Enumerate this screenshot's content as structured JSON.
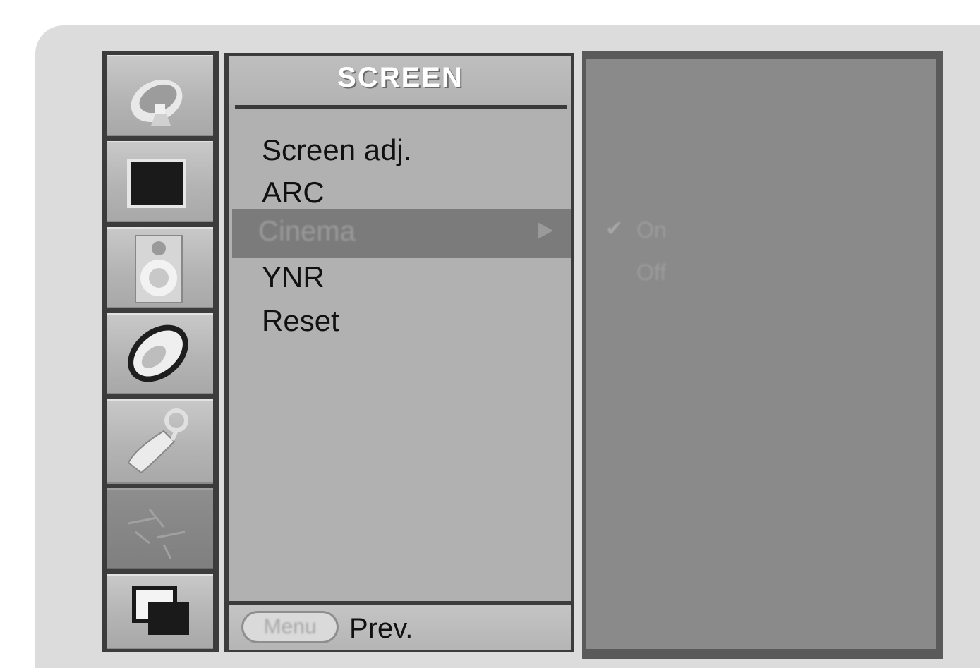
{
  "menu": {
    "title": "SCREEN",
    "items": [
      {
        "label": "Screen adj."
      },
      {
        "label": "ARC"
      },
      {
        "label": "Cinema",
        "selected": true
      },
      {
        "label": "YNR"
      },
      {
        "label": "Reset"
      }
    ]
  },
  "submenu": {
    "options": [
      {
        "label": "On",
        "checked": true
      },
      {
        "label": "Off",
        "checked": false
      }
    ]
  },
  "footer": {
    "menu_button_label": "Menu",
    "prev_label": "Prev."
  },
  "sidebar": {
    "icons": [
      {
        "name": "station-icon"
      },
      {
        "name": "picture-icon"
      },
      {
        "name": "sound-icon"
      },
      {
        "name": "time-icon"
      },
      {
        "name": "special-icon"
      },
      {
        "name": "screen-icon",
        "active": true
      },
      {
        "name": "pip-icon"
      }
    ]
  },
  "colors": {
    "frame": "#dcdcdc",
    "panel": "#b1b1b1",
    "selection": "#7b7b7b",
    "subpanel": "#8a8a8a"
  }
}
